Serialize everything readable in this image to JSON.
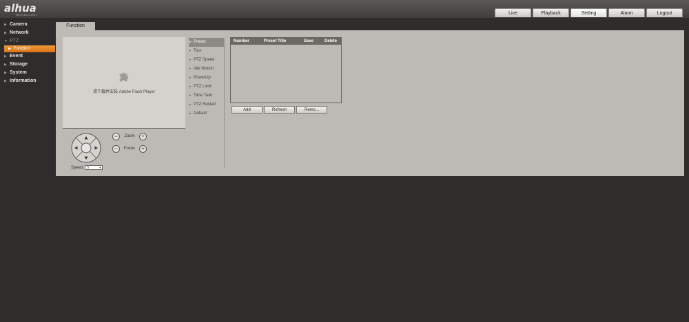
{
  "header": {
    "logo": "alhua",
    "logo_sub": "TECHNOLOGY",
    "tabs": [
      {
        "label": "Live"
      },
      {
        "label": "Playback"
      },
      {
        "label": "Setting"
      },
      {
        "label": "Alarm"
      },
      {
        "label": "Logout"
      }
    ],
    "active_tab": "Setting"
  },
  "sidebar": {
    "items": [
      {
        "label": "Camera"
      },
      {
        "label": "Network"
      },
      {
        "label": "PTZ"
      },
      {
        "label": "Event"
      },
      {
        "label": "Storage"
      },
      {
        "label": "System"
      },
      {
        "label": "Information"
      }
    ],
    "sub_item": {
      "label": "Function"
    }
  },
  "content": {
    "section_tab": "Function",
    "plugin_message": "请下载并安装 Adobe Flash Player",
    "zoom_label": "Zoom",
    "focus_label": "Focus",
    "speed_label": "Speed",
    "speed_value": "5",
    "menu": [
      {
        "label": "Preset"
      },
      {
        "label": "Tour"
      },
      {
        "label": "PTZ Speed"
      },
      {
        "label": "Idle Motion"
      },
      {
        "label": "PowerUp"
      },
      {
        "label": "PTZ Limit"
      },
      {
        "label": "Time Task"
      },
      {
        "label": "PTZ Restart"
      },
      {
        "label": "Default"
      }
    ],
    "table_headers": [
      "Number",
      "Preset Title",
      "Save",
      "Delete"
    ],
    "buttons": {
      "add": "Add",
      "refresh": "Refresh",
      "remove": "Remo..."
    }
  },
  "colors": {
    "accent": "#e8862a",
    "panel": "#bdbab5",
    "background": "#2e2d2b"
  }
}
